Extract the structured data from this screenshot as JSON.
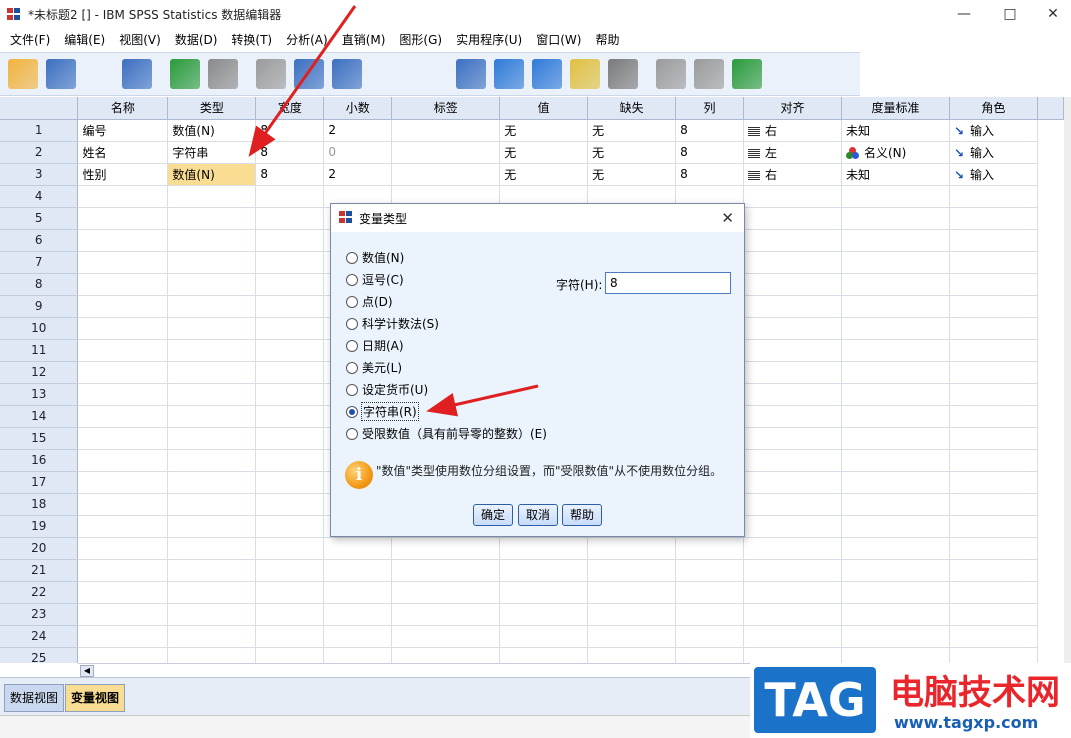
{
  "window": {
    "title": "*未标题2 [] - IBM SPSS Statistics 数据编辑器"
  },
  "menu": [
    "文件(F)",
    "编辑(E)",
    "视图(V)",
    "数据(D)",
    "转换(T)",
    "分析(A)",
    "直销(M)",
    "图形(G)",
    "实用程序(U)",
    "窗口(W)",
    "帮助"
  ],
  "toolbar": {
    "icons": [
      "open-folder-icon",
      "save-icon",
      "print-icon",
      "dialog-recall-icon",
      "undo-icon",
      "redo-icon",
      "goto-case-icon",
      "goto-variable-icon",
      "variables-icon",
      "find-icon",
      "insert-cases-icon",
      "insert-variable-icon",
      "split-file-icon",
      "weight-cases-icon",
      "select-cases-icon",
      "value-labels-icon",
      "use-sets-icon",
      "show-all-variables-icon",
      "spell-check-icon"
    ]
  },
  "grid": {
    "columns": [
      "名称",
      "类型",
      "宽度",
      "小数",
      "标签",
      "值",
      "缺失",
      "列",
      "对齐",
      "度量标准",
      "角色"
    ],
    "rows": [
      {
        "num": "1",
        "name": "编号",
        "type": "数值(N)",
        "width": "8",
        "decimals": "2",
        "label": "",
        "values": "无",
        "missing": "无",
        "columns": "8",
        "align": "右",
        "measure": "未知",
        "role": "输入"
      },
      {
        "num": "2",
        "name": "姓名",
        "type": "字符串",
        "width": "8",
        "decimals": "0",
        "label": "",
        "values": "无",
        "missing": "无",
        "columns": "8",
        "align": "左",
        "measure": "名义(N)",
        "role": "输入"
      },
      {
        "num": "3",
        "name": "性别",
        "type": "数值(N)",
        "width": "8",
        "decimals": "2",
        "label": "",
        "values": "无",
        "missing": "无",
        "columns": "8",
        "align": "右",
        "measure": "未知",
        "role": "输入"
      }
    ],
    "empty_rows": [
      "4",
      "5",
      "6",
      "7",
      "8",
      "9",
      "10",
      "11",
      "12",
      "13",
      "14",
      "15",
      "16",
      "17",
      "18",
      "19",
      "20",
      "21",
      "22",
      "23",
      "24",
      "25"
    ]
  },
  "tabs": {
    "data_view": "数据视图",
    "variable_view": "变量视图"
  },
  "dialog": {
    "title": "变量类型",
    "options": [
      "数值(N)",
      "逗号(C)",
      "点(D)",
      "科学计数法(S)",
      "日期(A)",
      "美元(L)",
      "设定货币(U)",
      "字符串(R)",
      "受限数值（具有前导零的整数）(E)"
    ],
    "selected_index": 7,
    "characters_label": "字符(H):",
    "characters_value": "8",
    "info": "\"数值\"类型使用数位分组设置，而\"受限数值\"从不使用数位分组。",
    "ok": "确定",
    "cancel": "取消",
    "help": "帮助"
  },
  "watermark": {
    "badge": "TAG",
    "site_name": "电脑技术网",
    "url": "www.tagxp.com"
  },
  "colors": {
    "header_bg": "#dfe8f4",
    "selected_cell": "#f9dd92",
    "dialog_bg": "#ebf3fd",
    "arrow": "#e02020",
    "watermark_red": "#e8262b",
    "watermark_blue": "#1a73c9"
  }
}
